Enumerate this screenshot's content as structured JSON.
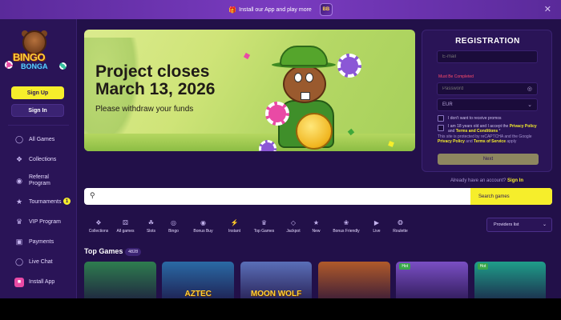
{
  "topbar": {
    "install_text": "Install our App and play more",
    "gift_icon": "gift-icon",
    "app_icon": "app-icon",
    "close_icon": "close-icon"
  },
  "brand": {
    "line1": "BINGO",
    "line2": "BONGA"
  },
  "sidebar": {
    "signup_label": "Sign Up",
    "signin_label": "Sign In",
    "items": [
      {
        "label": "All Games",
        "icon": "tag-icon"
      },
      {
        "label": "Collections",
        "icon": "collections-icon"
      },
      {
        "label": "Referral Program",
        "icon": "referral-icon"
      },
      {
        "label": "Tournaments",
        "icon": "trophy-icon",
        "badge": "1"
      },
      {
        "label": "VIP Program",
        "icon": "vip-icon"
      },
      {
        "label": "Payments",
        "icon": "wallet-icon"
      },
      {
        "label": "Live Chat",
        "icon": "chat-icon"
      },
      {
        "label": "Install App",
        "icon": "app-icon"
      }
    ]
  },
  "banner": {
    "title_line1": "Project closes",
    "title_line2": "March 13, 2026",
    "subtitle": "Please withdraw your funds"
  },
  "registration": {
    "title": "REGISTRATION",
    "email_placeholder": "E-mail",
    "required_text": "Must Be Completed",
    "password_placeholder": "Password",
    "currency_value": "EUR",
    "promo_text": "I don't want to receive promos",
    "age_text_1": "I am 18 years old and I accept the ",
    "privacy_link": "Privacy Policy",
    "and_text": " and ",
    "terms_link": "Terms and Conditions",
    "age_star": " *",
    "captcha_text_1": "This site is protected by reCAPTCHA and the Google ",
    "captcha_text_2": " apply",
    "next_label": "Next",
    "already_text": "Already have an account? ",
    "signin_link": "Sign In"
  },
  "search": {
    "placeholder": "",
    "button_label": "Search games"
  },
  "categories": [
    {
      "label": "Collections",
      "icon": "collections-icon"
    },
    {
      "label": "All games",
      "icon": "dice-icon"
    },
    {
      "label": "Slots",
      "icon": "cherry-icon"
    },
    {
      "label": "Bingo",
      "icon": "bingo-icon"
    },
    {
      "label": "Bonus Buy",
      "icon": "bonus-icon"
    },
    {
      "label": "Instant",
      "icon": "lightning-icon"
    },
    {
      "label": "Top Games",
      "icon": "crown-icon"
    },
    {
      "label": "Jackpot",
      "icon": "diamond-icon"
    },
    {
      "label": "New",
      "icon": "new-icon"
    },
    {
      "label": "Bonus Friendly",
      "icon": "gift-icon"
    },
    {
      "label": "Live",
      "icon": "live-icon"
    },
    {
      "label": "Roulette",
      "icon": "roulette-icon"
    }
  ],
  "providers": {
    "label": "Providers list"
  },
  "top_games": {
    "title": "Top Games",
    "count": "4828",
    "games": [
      {
        "title": "",
        "hot": "",
        "bg": "#2e7d4f"
      },
      {
        "title": "AZTEC",
        "hot": "",
        "bg": "#2a6aa5"
      },
      {
        "title": "MOON WOLF",
        "hot": "",
        "bg": "#5a6fb8"
      },
      {
        "title": "",
        "hot": "",
        "bg": "#b05a2a"
      },
      {
        "title": "",
        "hot": "Hot",
        "bg": "#7a4fc4"
      },
      {
        "title": "",
        "hot": "Hot",
        "bg": "#1f9e8a"
      }
    ]
  }
}
